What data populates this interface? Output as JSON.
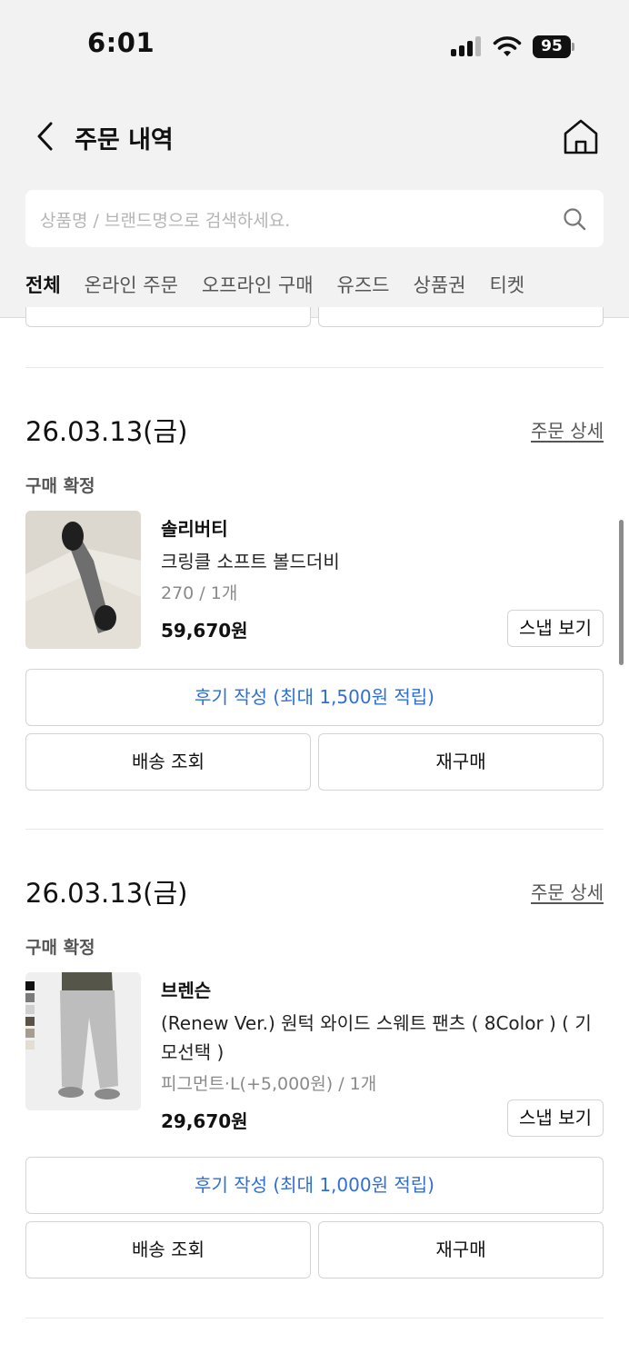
{
  "status_bar": {
    "time": "6:01",
    "battery": "95"
  },
  "header": {
    "title": "주문 내역"
  },
  "search": {
    "placeholder": "상품명 / 브랜드명으로 검색하세요."
  },
  "tabs": [
    {
      "label": "전체",
      "active": true
    },
    {
      "label": "온라인 주문",
      "active": false
    },
    {
      "label": "오프라인 구매",
      "active": false
    },
    {
      "label": "유즈드",
      "active": false
    },
    {
      "label": "상품권",
      "active": false
    },
    {
      "label": "티켓",
      "active": false
    }
  ],
  "orders": [
    {
      "date": "26.03.13(금)",
      "detail_link": "주문 상세",
      "status": "구매 확정",
      "brand": "솔리버티",
      "product_name": "크링클 소프트 볼드더비",
      "option": "270 / 1개",
      "price": "59,670원",
      "snap_button": "스냅 보기",
      "review_button": "후기 작성 (최대 1,500원 적립)",
      "delivery_button": "배송 조회",
      "rebuy_button": "재구매"
    },
    {
      "date": "26.03.13(금)",
      "detail_link": "주문 상세",
      "status": "구매 확정",
      "brand": "브렌슨",
      "product_name": "(Renew Ver.) 원턱 와이드 스웨트 팬츠 ( 8Color ) ( 기모선택 )",
      "option": "피그먼트·L(+5,000원) / 1개",
      "price": "29,670원",
      "snap_button": "스냅 보기",
      "review_button": "후기 작성 (최대 1,000원 적립)",
      "delivery_button": "배송 조회",
      "rebuy_button": "재구매"
    }
  ],
  "colors": {
    "accent_link": "#2f6fd6",
    "header_bg": "#f2f2f2"
  },
  "icons": [
    "back-chevron-icon",
    "home-icon",
    "search-icon",
    "signal-icon",
    "wifi-icon",
    "battery-icon"
  ]
}
